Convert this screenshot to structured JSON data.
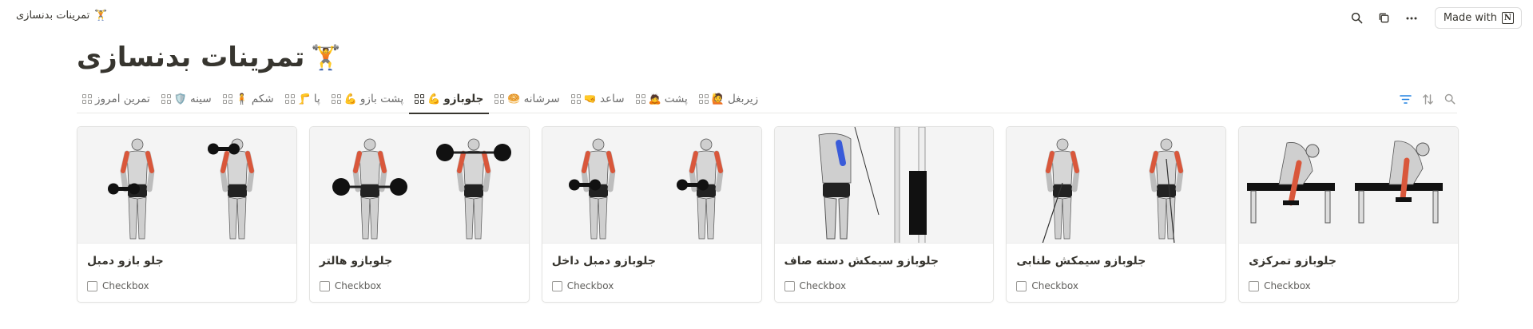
{
  "breadcrumb": {
    "title": "تمرینات بدنسازی",
    "emoji": "🏋️"
  },
  "topbar": {
    "made_with_label": "Made with",
    "notion_letter": "N"
  },
  "page": {
    "title": "تمرینات بدنسازی",
    "emoji": "🏋️"
  },
  "tabs": [
    {
      "label": "زیربغل",
      "emoji": "🙋"
    },
    {
      "label": "پشت",
      "emoji": "🙇"
    },
    {
      "label": "ساعد",
      "emoji": "🤜"
    },
    {
      "label": "سرشانه",
      "emoji": "🥯"
    },
    {
      "label": "جلوبازو",
      "emoji": "💪",
      "active": true
    },
    {
      "label": "پشت بازو",
      "emoji": "💪"
    },
    {
      "label": "پا",
      "emoji": "🦵"
    },
    {
      "label": "شکم",
      "emoji": "🧍"
    },
    {
      "label": "سینه",
      "emoji": "🛡️"
    },
    {
      "label": "تمرین امروز",
      "emoji": ""
    }
  ],
  "cards": [
    {
      "title": "جلوبازو تمرکزی",
      "prop_label": "Checkbox"
    },
    {
      "title": "جلوبازو سیمکش طنابی",
      "prop_label": "Checkbox"
    },
    {
      "title": "جلوبازو سیمکش دسته صاف",
      "prop_label": "Checkbox"
    },
    {
      "title": "جلوبازو دمبل داخل",
      "prop_label": "Checkbox"
    },
    {
      "title": "جلوبازو هالتر",
      "prop_label": "Checkbox"
    },
    {
      "title": "جلو بازو دمبل",
      "prop_label": "Checkbox"
    }
  ],
  "colors": {
    "accent_filter": "#2383e2",
    "muscle_highlight": "#d9573b",
    "muscle_highlight_back": "#3a5bd9"
  }
}
